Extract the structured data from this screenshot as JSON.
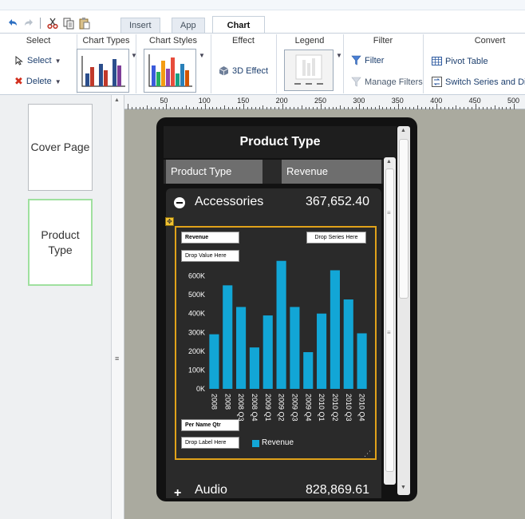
{
  "toolbar": {
    "tabs": [
      "Insert",
      "App",
      "Chart"
    ],
    "groups": {
      "select": "Select",
      "chart_types": "Chart Types",
      "chart_styles": "Chart Styles",
      "effect": "Effect",
      "legend": "Legend",
      "filter": "Filter",
      "convert": "Convert"
    },
    "select_label": "Select",
    "delete_label": "Delete",
    "effect_3d": "3D Effect",
    "filter_label": "Filter",
    "manage_filters": "Manage Filters",
    "pivot_table": "Pivot Table",
    "switch_series": "Switch Series and Dim"
  },
  "ruler": {
    "labels": [
      "50",
      "100",
      "150",
      "200",
      "250",
      "300",
      "350",
      "400",
      "450",
      "500"
    ]
  },
  "pages": [
    "Cover Page",
    "Product Type"
  ],
  "report": {
    "title": "Product Type",
    "columns": [
      "Product Type",
      "Revenue"
    ],
    "groups": [
      {
        "name": "Accessories",
        "value": "367,652.40"
      },
      {
        "name": "Audio",
        "value": "828,869.61"
      }
    ]
  },
  "chart_data": {
    "type": "bar",
    "ylabel": "Revenue",
    "categories": [
      "2008",
      "2008",
      "2008 Q3",
      "2008 Q4",
      "2009 Q1",
      "2009 Q2",
      "2009 Q3",
      "2009 Q4",
      "2010 Q1",
      "2010 Q2",
      "2010 Q3",
      "2010 Q4"
    ],
    "series": [
      {
        "name": "Revenue",
        "values": [
          290000,
          550000,
          435000,
          220000,
          390000,
          680000,
          435000,
          195000,
          400000,
          630000,
          475000,
          295000
        ]
      }
    ],
    "yticks": [
      "0K",
      "100K",
      "200K",
      "300K",
      "400K",
      "500K",
      "600K"
    ],
    "ylim": [
      0,
      700000
    ],
    "drop_zones": {
      "series": "Drop Series Here",
      "value": "Drop Value Here",
      "dimension": "Per Name Qtr",
      "label": "Drop Label Here"
    },
    "legend": "Revenue",
    "colors": {
      "bar": "#12a6d6",
      "frame": "#e0a21a",
      "background": "#2a2a2a"
    }
  }
}
